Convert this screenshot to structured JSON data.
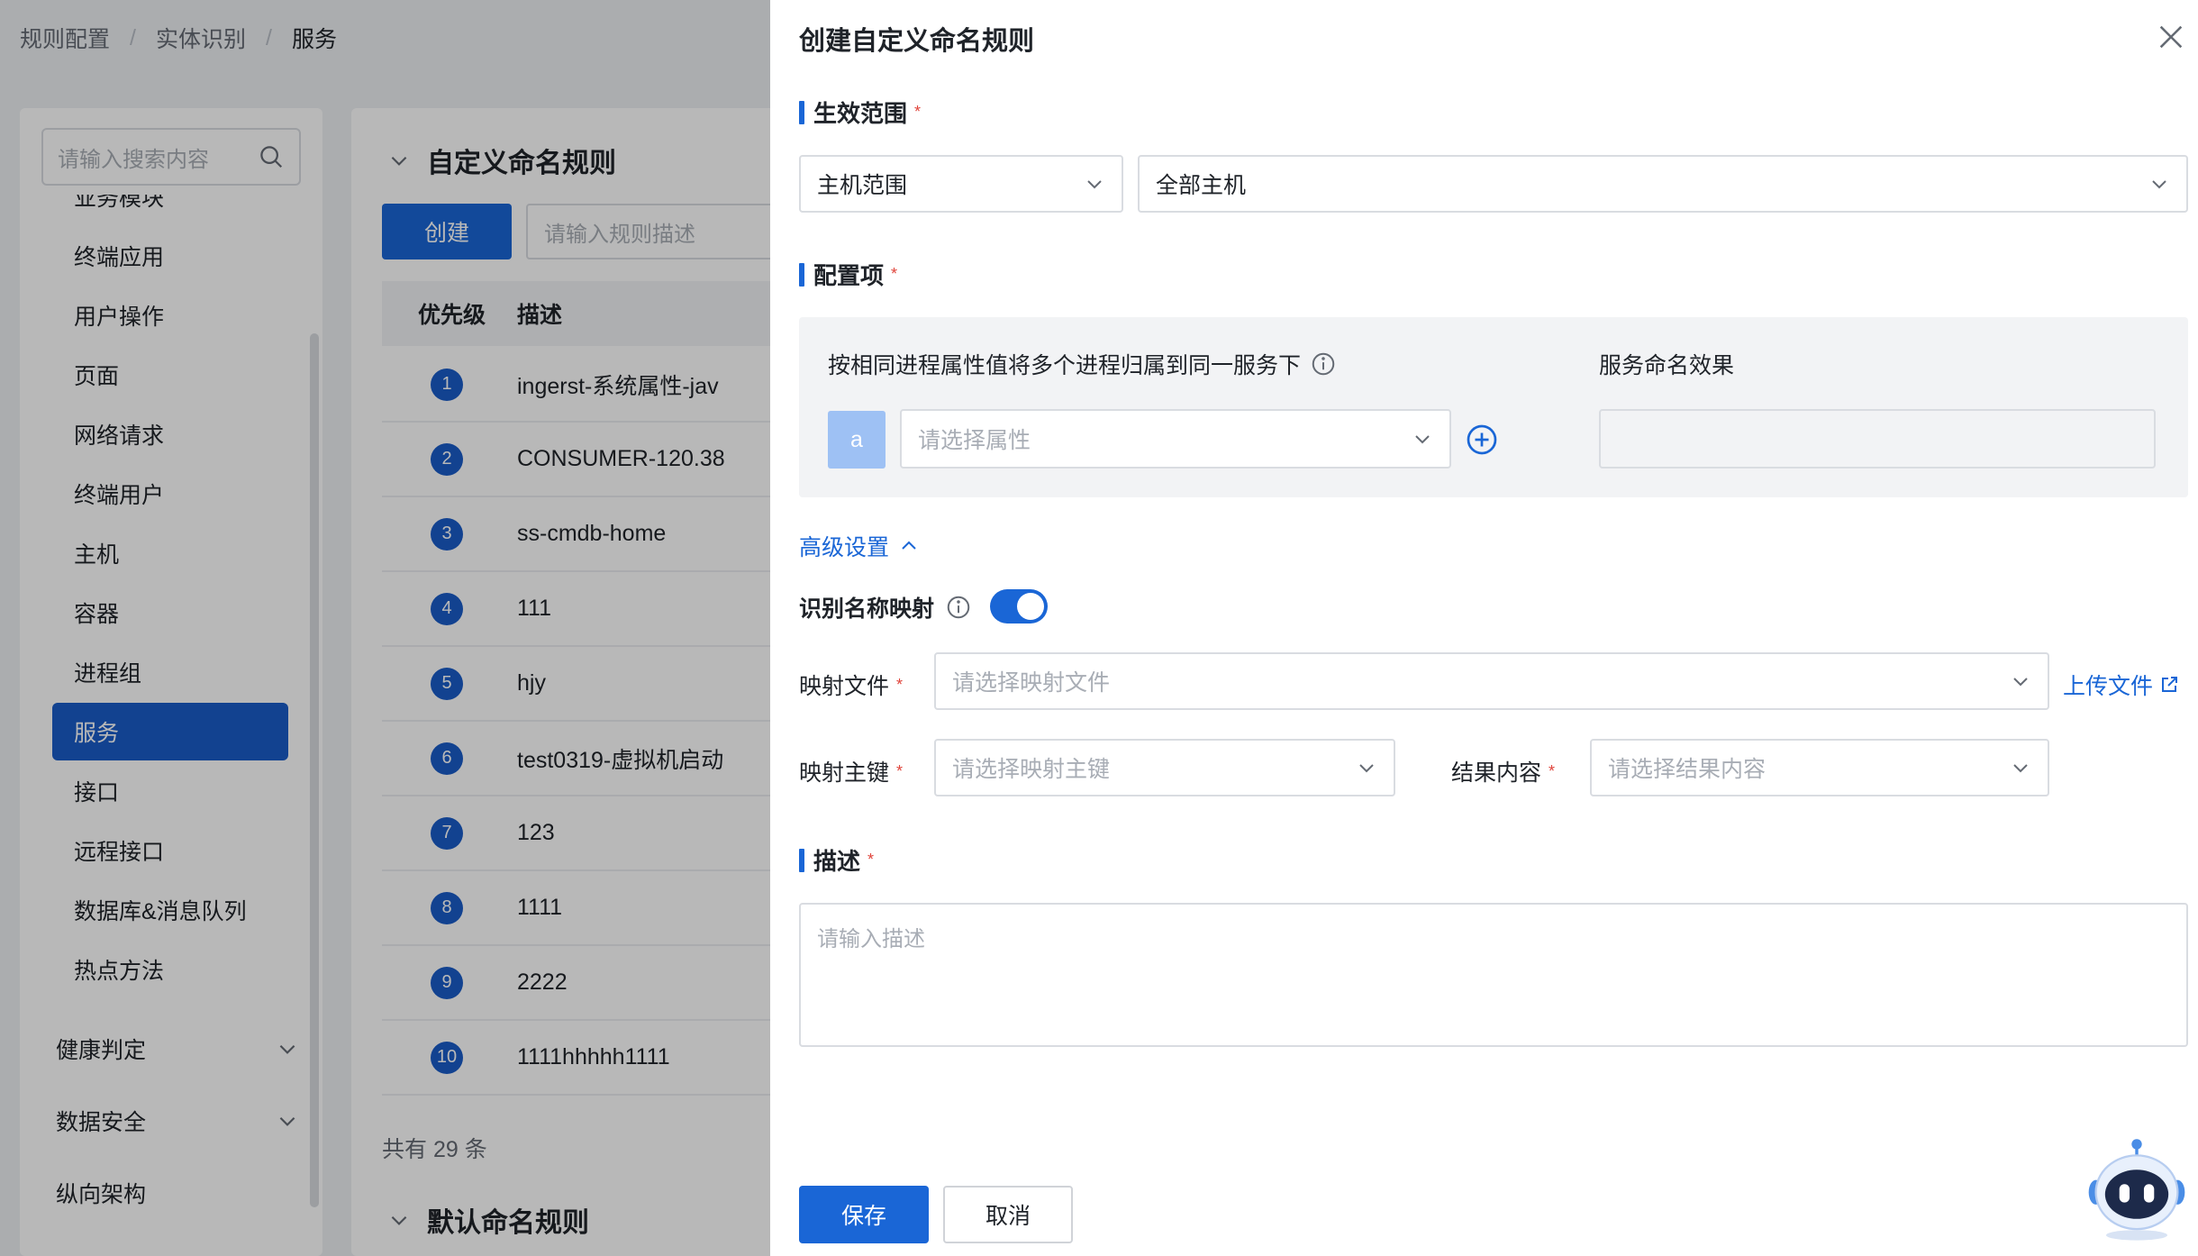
{
  "breadcrumb": [
    "规则配置",
    "实体识别",
    "服务"
  ],
  "sidebar": {
    "search_placeholder": "请输入搜索内容",
    "items": [
      {
        "label": "业务模块",
        "active": false
      },
      {
        "label": "终端应用",
        "active": false
      },
      {
        "label": "用户操作",
        "active": false
      },
      {
        "label": "页面",
        "active": false
      },
      {
        "label": "网络请求",
        "active": false
      },
      {
        "label": "终端用户",
        "active": false
      },
      {
        "label": "主机",
        "active": false
      },
      {
        "label": "容器",
        "active": false
      },
      {
        "label": "进程组",
        "active": false
      },
      {
        "label": "服务",
        "active": true
      },
      {
        "label": "接口",
        "active": false
      },
      {
        "label": "远程接口",
        "active": false
      },
      {
        "label": "数据库&消息队列",
        "active": false
      },
      {
        "label": "热点方法",
        "active": false
      }
    ],
    "groups": [
      "健康判定",
      "数据安全",
      "纵向架构"
    ]
  },
  "main": {
    "custom_section_title": "自定义命名规则",
    "create_label": "创建",
    "rule_search_placeholder": "请输入规则描述",
    "columns": [
      "优先级",
      "描述"
    ],
    "rows": [
      {
        "priority": "1",
        "desc": "ingerst-系统属性-jav"
      },
      {
        "priority": "2",
        "desc": "CONSUMER-120.38"
      },
      {
        "priority": "3",
        "desc": "ss-cmdb-home"
      },
      {
        "priority": "4",
        "desc": "111"
      },
      {
        "priority": "5",
        "desc": "hjy"
      },
      {
        "priority": "6",
        "desc": "test0319-虚拟机启动"
      },
      {
        "priority": "7",
        "desc": "123"
      },
      {
        "priority": "8",
        "desc": "1111"
      },
      {
        "priority": "9",
        "desc": "2222"
      },
      {
        "priority": "10",
        "desc": "1111hhhhh1111"
      }
    ],
    "total": "共有 29 条",
    "default_section_title": "默认命名规则"
  },
  "drawer": {
    "title": "创建自定义命名规则",
    "scope_label": "生效范围",
    "scope_type": "主机范围",
    "scope_value": "全部主机",
    "config_label": "配置项",
    "config_desc": "按相同进程属性值将多个进程归属到同一服务下",
    "effect_label": "服务命名效果",
    "attr_letter": "a",
    "attr_placeholder": "请选择属性",
    "advanced_label": "高级设置",
    "mapping_label": "识别名称映射",
    "mapping_enabled": true,
    "map_file_label": "映射文件",
    "map_file_placeholder": "请选择映射文件",
    "upload_label": "上传文件",
    "map_key_label": "映射主键",
    "map_key_placeholder": "请选择映射主键",
    "result_label": "结果内容",
    "result_placeholder": "请选择结果内容",
    "desc_label": "描述",
    "desc_placeholder": "请输入描述",
    "save_label": "保存",
    "cancel_label": "取消",
    "required_mark": "*"
  },
  "colors": {
    "primary": "#1a66d6",
    "active_nav": "#1a5cc8",
    "required": "#e0443b"
  }
}
